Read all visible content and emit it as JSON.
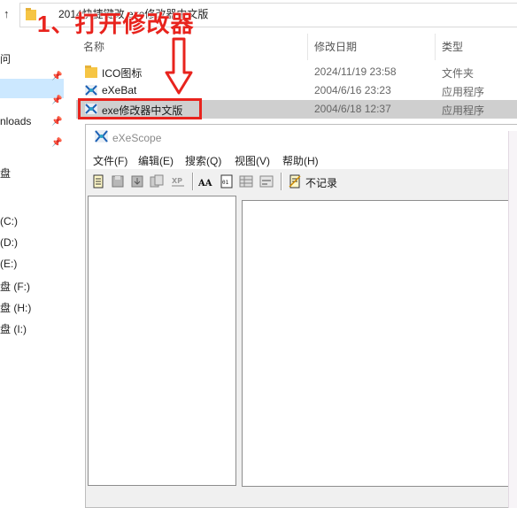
{
  "explorer": {
    "address_path": "2014快捷键改  exe修改器中文版",
    "nav_items": [
      {
        "label": "问",
        "pinned": false
      },
      {
        "label": "",
        "pinned": true
      },
      {
        "label": "",
        "pinned": true
      },
      {
        "label": "nloads",
        "pinned": true
      },
      {
        "label": "",
        "pinned": true
      },
      {
        "label": "盘",
        "pinned": false
      },
      {
        "label": "(C:)",
        "pinned": false
      },
      {
        "label": "(D:)",
        "pinned": false
      },
      {
        "label": "(E:)",
        "pinned": false
      },
      {
        "label": "盘 (F:)",
        "pinned": false
      },
      {
        "label": "盘 (H:)",
        "pinned": false
      },
      {
        "label": "盘 (I:)",
        "pinned": false
      }
    ],
    "columns": {
      "name": "名称",
      "date": "修改日期",
      "type": "类型"
    },
    "files": [
      {
        "name": "ICO图标",
        "date": "2024/11/19 23:58",
        "type": "文件夹",
        "icon": "folder-icon"
      },
      {
        "name": "eXeBat",
        "date": "2004/6/16 23:23",
        "type": "应用程序",
        "icon": "exe-icon"
      },
      {
        "name": "exe修改器中文版",
        "date": "2004/6/18 12:37",
        "type": "应用程序",
        "icon": "exe-icon",
        "selected": true
      }
    ]
  },
  "annotation": {
    "text": "1、打开修改器",
    "color": "#e8231d"
  },
  "app": {
    "title": "eXeScope",
    "menu": [
      "文件(F)",
      "编辑(E)",
      "搜索(Q)",
      "视图(V)",
      "帮助(H)"
    ],
    "toolbar_icons": [
      "open-file-icon",
      "save-icon",
      "export-icon",
      "import-icon",
      "xp-style-icon",
      "font-icon",
      "binary-view-icon",
      "grid-view-icon",
      "dialog-view-icon",
      "no-record-icon"
    ],
    "toolbar_label": "不记录"
  }
}
